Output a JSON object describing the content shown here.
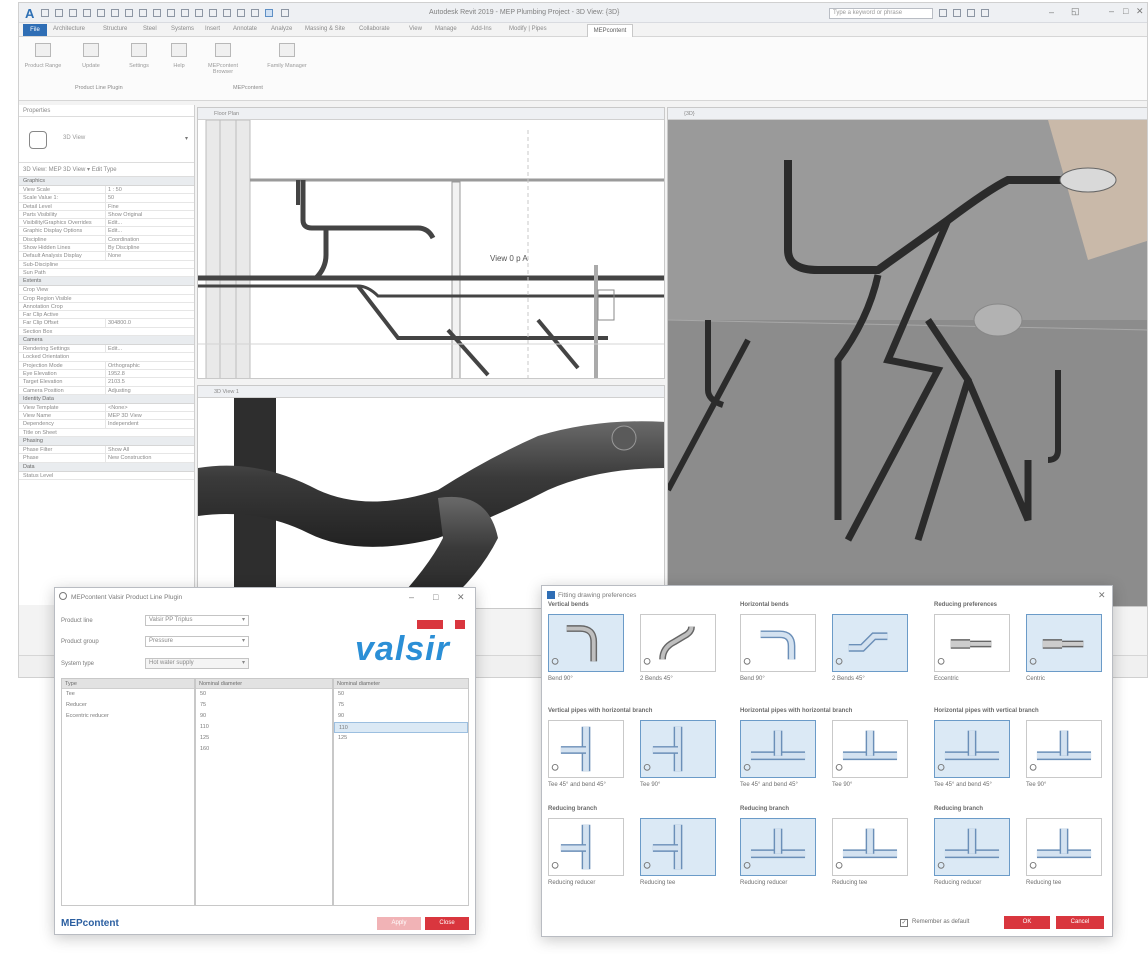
{
  "app": {
    "logo": "A",
    "title": "Autodesk Revit 2019 - MEP Plumbing Project - 3D View: {3D}",
    "search_placeholder": "Type a keyword or phrase",
    "ribbon_tabs": [
      "Architecture",
      "Structure",
      "Steel",
      "Systems",
      "Insert",
      "Annotate",
      "Analyze",
      "Massing & Site",
      "Collaborate",
      "View",
      "Manage",
      "Add-Ins",
      "Modify | Pipes",
      "MEPcontent"
    ],
    "file_tab": "File",
    "active_tab": "MEPcontent",
    "ribbon_buttons": [
      "Product Range",
      "Update",
      "Settings",
      "Help",
      "MEPcontent Browser",
      "Family Manager"
    ],
    "ribbon_groups": [
      "Product Line Plugin",
      "MEPcontent"
    ]
  },
  "properties": {
    "header": "Properties",
    "type_name": "3D View",
    "filter": "3D View: MEP 3D View  ▾  Edit Type",
    "groups": [
      {
        "name": "Graphics",
        "rows": [
          [
            "View Scale",
            "1 : 50"
          ],
          [
            "Scale Value 1:",
            "50"
          ],
          [
            "Detail Level",
            "Fine"
          ],
          [
            "Parts Visibility",
            "Show Original"
          ],
          [
            "Visibility/Graphics Overrides",
            "Edit..."
          ],
          [
            "Graphic Display Options",
            "Edit..."
          ],
          [
            "Discipline",
            "Coordination"
          ],
          [
            "Show Hidden Lines",
            "By Discipline"
          ],
          [
            "Default Analysis Display",
            "None"
          ],
          [
            "Sub-Discipline",
            ""
          ],
          [
            "Sun Path",
            ""
          ]
        ]
      },
      {
        "name": "Extents",
        "rows": [
          [
            "Crop View",
            ""
          ],
          [
            "Crop Region Visible",
            ""
          ],
          [
            "Annotation Crop",
            ""
          ],
          [
            "Far Clip Active",
            ""
          ],
          [
            "Far Clip Offset",
            "304800.0"
          ],
          [
            "Section Box",
            ""
          ]
        ]
      },
      {
        "name": "Camera",
        "rows": [
          [
            "Rendering Settings",
            "Edit..."
          ],
          [
            "Locked Orientation",
            ""
          ],
          [
            "Projection Mode",
            "Orthographic"
          ],
          [
            "Eye Elevation",
            "1952.8"
          ],
          [
            "Target Elevation",
            "2103.5"
          ],
          [
            "Camera Position",
            "Adjusting"
          ]
        ]
      },
      {
        "name": "Identity Data",
        "rows": [
          [
            "View Template",
            "<None>"
          ],
          [
            "View Name",
            "MEP 3D View"
          ],
          [
            "Dependency",
            "Independent"
          ],
          [
            "Title on Sheet",
            ""
          ]
        ]
      },
      {
        "name": "Phasing",
        "rows": [
          [
            "Phase Filter",
            "Show All"
          ],
          [
            "Phase",
            "New Construction"
          ]
        ]
      },
      {
        "name": "Data",
        "rows": [
          [
            "Status Level",
            ""
          ]
        ]
      }
    ]
  },
  "views": {
    "plan_tab": "Floor Plan",
    "plan_label": "View 0 p A",
    "iso_tab": "3D View 1",
    "main3d_tab": "{3D}"
  },
  "valsir": {
    "title": "MEPcontent Valsir Product Line Plugin",
    "logo": "valsir",
    "fields": [
      {
        "label": "Product line",
        "value": "Valsir PP Triplus"
      },
      {
        "label": "Product group",
        "value": "Pressure"
      },
      {
        "label": "System type",
        "value": "Hot water supply"
      }
    ],
    "columns": [
      "Type",
      "Nominal diameter",
      "Nominal diameter"
    ],
    "col1": [
      "Tee",
      "Reducer",
      "Eccentric reducer"
    ],
    "col2": [
      "50",
      "75",
      "90",
      "110",
      "125",
      "160"
    ],
    "col3": [
      "50",
      "75",
      "90",
      "110",
      "125"
    ],
    "col3_selected_index": 3,
    "footer_logo": "MEPcontent",
    "btn_apply": "Apply",
    "btn_close": "Close"
  },
  "fitting": {
    "title": "Fitting drawing preferences",
    "groups": [
      {
        "head": "Vertical bends",
        "items": [
          "Bend 90°",
          "2 Bends 45°"
        ],
        "sel": 0
      },
      {
        "head": "Horizontal bends",
        "items": [
          "Bend 90°",
          "2 Bends 45°"
        ],
        "sel": 1
      },
      {
        "head": "Reducing preferences",
        "items": [
          "Eccentric",
          "Centric"
        ],
        "sel": 1
      },
      {
        "head": "Vertical pipes with horizontal branch",
        "items": [
          "Tee 45° and bend 45°",
          "Tee 90°"
        ],
        "sel": 1
      },
      {
        "head": "Horizontal pipes with horizontal branch",
        "items": [
          "Tee 45° and bend 45°",
          "Tee 90°"
        ],
        "sel": 0
      },
      {
        "head": "Horizontal pipes with vertical branch",
        "items": [
          "Tee 45° and bend 45°",
          "Tee 90°"
        ],
        "sel": 0
      },
      {
        "head": "Reducing branch",
        "items": [
          "Reducing reducer",
          "Reducing tee"
        ],
        "sel": 1
      },
      {
        "head": "Reducing branch",
        "items": [
          "Reducing reducer",
          "Reducing tee"
        ],
        "sel": 0
      },
      {
        "head": "Reducing branch",
        "items": [
          "Reducing reducer",
          "Reducing tee"
        ],
        "sel": 0
      }
    ],
    "remember": "Remember as default",
    "btn_ok": "OK",
    "btn_cancel": "Cancel"
  },
  "colors": {
    "accent": "#2f6eb5",
    "valsir": "#2b8fd6",
    "red": "#d9363e",
    "pipe": "#3a3a3a"
  }
}
